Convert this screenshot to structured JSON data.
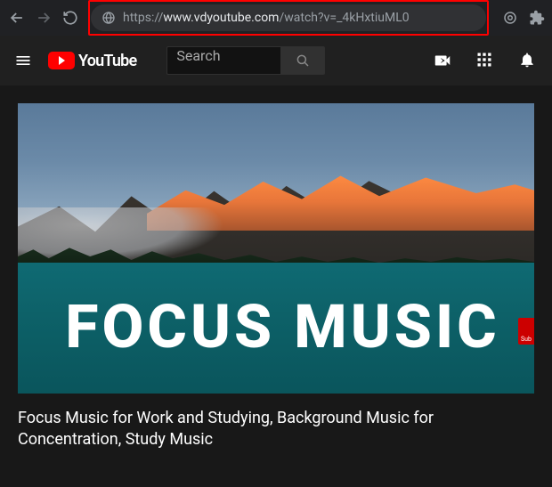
{
  "browser": {
    "url_scheme": "https://",
    "url_host": "www.vdyoutube.com",
    "url_path": "/watch?v=_4kHxtiuML0"
  },
  "youtube_header": {
    "logo_text": "YouTube",
    "search_placeholder": "Search"
  },
  "video": {
    "overlay_text": "FOCUS MUSIC",
    "subscribe_badge": "Sub",
    "title": "Focus Music for Work and Studying, Background Music for Concentration, Study Music"
  }
}
